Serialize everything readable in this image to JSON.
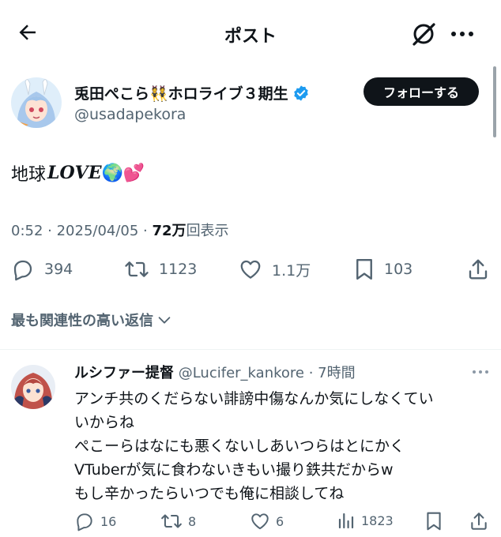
{
  "header": {
    "title": "ポスト"
  },
  "post": {
    "display_name": "兎田ぺこら👯ホロライブ３期生",
    "handle": "@usadapekora",
    "follow_label": "フォローする",
    "text_prefix": "地球",
    "text_love": "𝑳𝑶𝑽𝑬",
    "text_emoji": "🌍💕",
    "time_date": "0:52 · 2025/04/05 · ",
    "views_count": "72万",
    "views_label": "回表示",
    "replies": "394",
    "reposts": "1123",
    "likes": "1.1万",
    "bookmarks": "103"
  },
  "sort_label": "最も関連性の高い返信",
  "reply": {
    "name": "ルシファー提督",
    "handle_time": " @Lucifer_kankore · 7時間",
    "lines": [
      "アンチ共のくだらない誹謗中傷なんか気にしなくてい",
      "いからね",
      "ぺこーらはなにも悪くないしあいつらはとにかく",
      "VTuberが気に食わないきもい撮り鉄共だからw",
      "もし辛かったらいつでも俺に相談してね"
    ],
    "replies": "16",
    "reposts": "8",
    "likes": "6",
    "views": "1823"
  },
  "colors": {
    "text": "#0f1419",
    "secondary": "#536471",
    "verified": "#1d9bf0",
    "divider": "#eff3f4"
  }
}
